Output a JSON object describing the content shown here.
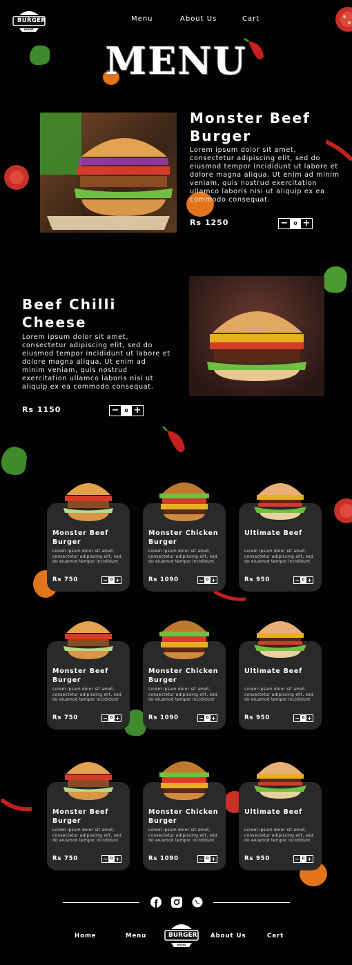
{
  "header": {
    "logo_text": "BURGER",
    "logo_sub": "HOUSE",
    "nav": [
      "Menu",
      "About Us",
      "Cart"
    ]
  },
  "page_title": "MENU",
  "featured": [
    {
      "name_line1": "Monster Beef",
      "name_line2": "Burger",
      "description": "Lorem ipsum dolor sit amet, consectetur adipiscing elit, sed do eiusmod tempor incididunt ut labore et dolore magna aliqua. Ut enim ad minim veniam, quis nostrud exercitation ullamco laboris nisi ut aliquip ex ea commodo consequat.",
      "price": "Rs 1250",
      "qty": "0"
    },
    {
      "name_line1": "Beef Chilli",
      "name_line2": "Cheese",
      "description": "Lorem ipsum dolor sit amet, consectetur adipiscing elit, sed do eiusmod tempor incididunt ut labore et dolore magna aliqua. Ut enim ad minim veniam, quis nostrud exercitation ullamco laboris nisi ut aliquip ex ea commodo consequat.",
      "price": "Rs 1150",
      "qty": "0"
    }
  ],
  "cards": [
    {
      "line1": "Monster Beef",
      "line2": "Burger",
      "desc": "Lorem ipsum dolor sit amet, consectetur adipiscing elit, sed do eiusmod tempor incididunt",
      "price": "Rs 750",
      "qty": "0"
    },
    {
      "line1": "Monster Chicken",
      "line2": "Burger",
      "desc": "Lorem ipsum dolor sit amet, consectetur adipiscing elit, sed do eiusmod tempor incididunt",
      "price": "Rs 1090",
      "qty": "0"
    },
    {
      "line1": "Ultimate Beef",
      "line2": "",
      "desc": "Lorem ipsum dolor sit amet, consectetur adipiscing elit, sed do eiusmod tempor incididunt",
      "price": "Rs 950",
      "qty": "0"
    },
    {
      "line1": "Monster Beef",
      "line2": "Burger",
      "desc": "Lorem ipsum dolor sit amet, consectetur adipiscing elit, sed do eiusmod tempor incididunt",
      "price": "Rs 750",
      "qty": "0"
    },
    {
      "line1": "Monster Chicken",
      "line2": "Burger",
      "desc": "Lorem ipsum dolor sit amet, consectetur adipiscing elit, sed do eiusmod tempor incididunt",
      "price": "Rs 1090",
      "qty": "0"
    },
    {
      "line1": "Ultimate Beef",
      "line2": "",
      "desc": "Lorem ipsum dolor sit amet, consectetur adipiscing elit, sed do eiusmod tempor incididunt",
      "price": "Rs 950",
      "qty": "0"
    },
    {
      "line1": "Monster Beef",
      "line2": "Burger",
      "desc": "Lorem ipsum dolor sit amet, consectetur adipiscing elit, sed do eiusmod tempor incididunt",
      "price": "Rs 750",
      "qty": "0"
    },
    {
      "line1": "Monster Chicken",
      "line2": "Burger",
      "desc": "Lorem ipsum dolor sit amet, consectetur adipiscing elit, sed do eiusmod tempor incididunt",
      "price": "Rs 1090",
      "qty": "0"
    },
    {
      "line1": "Ultimate Beef",
      "line2": "",
      "desc": "Lorem ipsum dolor sit amet, consectetur adipiscing elit, sed do eiusmod tempor incididunt",
      "price": "Rs 950",
      "qty": "0"
    }
  ],
  "footer": {
    "social_icons": [
      "facebook-icon",
      "instagram-icon",
      "whatsapp-icon"
    ],
    "nav": [
      "Home",
      "Menu",
      "About Us",
      "Cart"
    ]
  },
  "colors": {
    "background": "#030303",
    "card": "#2a2a2a",
    "text": "#ffffff"
  }
}
